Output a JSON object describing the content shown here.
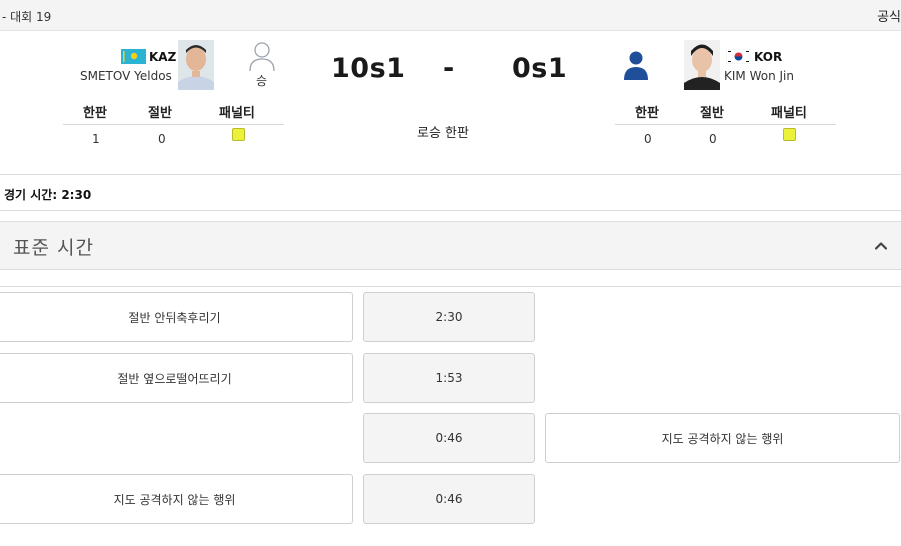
{
  "header": {
    "left_text": "- 대회 19",
    "right_text": "공식"
  },
  "red": {
    "country": "KAZ",
    "name": "SMETOV Yeldos",
    "score": "10s1",
    "winner_label": "승",
    "stats_headers": [
      "한판",
      "절반",
      "패널티"
    ],
    "ippon": "1",
    "waza_ari": "0"
  },
  "blue": {
    "country": "KOR",
    "name": "KIM Won Jin",
    "score": "0s1",
    "stats_headers": [
      "한판",
      "절반",
      "패널티"
    ],
    "ippon": "0",
    "waza_ari": "0"
  },
  "score_separator": "-",
  "result_text": "로승 한판",
  "match_time": "경기 시간: 2:30",
  "section_title": "표준 시간",
  "events": [
    {
      "left": "절반 안뒤축후리기",
      "time": "2:30",
      "right": ""
    },
    {
      "left": "절반 옆으로떨어뜨리기",
      "time": "1:53",
      "right": ""
    },
    {
      "left": "",
      "time": "0:46",
      "right": "지도 공격하지 않는 행위"
    },
    {
      "left": "지도 공격하지 않는 행위",
      "time": "0:46",
      "right": ""
    }
  ],
  "colors": {
    "penalty_card": "#ecf13a",
    "blue_icon": "#1f4f9a"
  },
  "icons": {
    "flag_kaz": "kazakhstan-flag",
    "flag_kor": "korea-flag",
    "winner": "person-outline-icon",
    "blue": "person-filled-icon",
    "collapse": "chevron-up-icon"
  }
}
